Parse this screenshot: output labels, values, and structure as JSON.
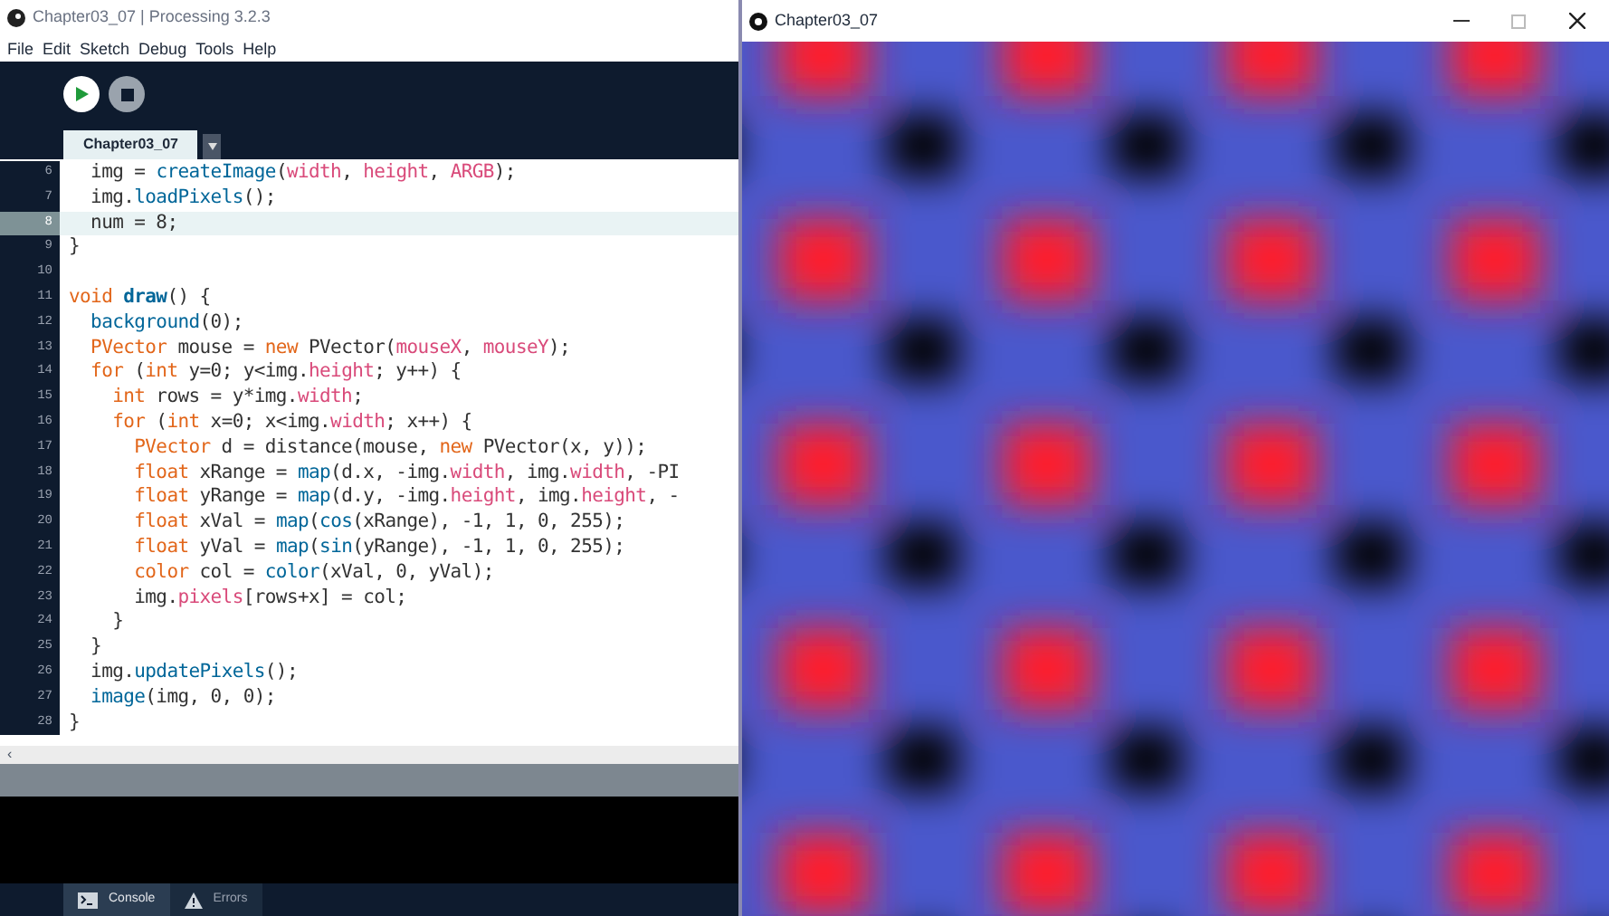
{
  "editor_window": {
    "title": "Chapter03_07 | Processing 3.2.3",
    "menu": [
      "File",
      "Edit",
      "Sketch",
      "Debug",
      "Tools",
      "Help"
    ],
    "tabs": [
      {
        "label": "Chapter03_07",
        "selected": true
      }
    ],
    "code_lines": [
      {
        "number": "6",
        "current": false,
        "tokens": [
          {
            "kind": "plain",
            "text": "  img = "
          },
          {
            "kind": "function",
            "text": "createImage"
          },
          {
            "kind": "plain",
            "text": "("
          },
          {
            "kind": "variable",
            "text": "width"
          },
          {
            "kind": "plain",
            "text": ", "
          },
          {
            "kind": "variable",
            "text": "height"
          },
          {
            "kind": "plain",
            "text": ", "
          },
          {
            "kind": "variable",
            "text": "ARGB"
          },
          {
            "kind": "plain",
            "text": ");"
          }
        ]
      },
      {
        "number": "7",
        "current": false,
        "tokens": [
          {
            "kind": "plain",
            "text": "  img."
          },
          {
            "kind": "function",
            "text": "loadPixels"
          },
          {
            "kind": "plain",
            "text": "();"
          }
        ]
      },
      {
        "number": "8",
        "current": true,
        "tokens": [
          {
            "kind": "plain",
            "text": "  num = 8;"
          }
        ]
      },
      {
        "number": "9",
        "current": false,
        "tokens": [
          {
            "kind": "plain",
            "text": "}"
          }
        ]
      },
      {
        "number": "10",
        "current": false
      },
      {
        "number": "11",
        "current": false,
        "tokens": [
          {
            "kind": "keyword",
            "text": "void "
          },
          {
            "kind": "definition",
            "text": "draw"
          },
          {
            "kind": "plain",
            "text": "() {"
          }
        ]
      },
      {
        "number": "12",
        "current": false,
        "tokens": [
          {
            "kind": "function",
            "text": "  background"
          },
          {
            "kind": "plain",
            "text": "(0);"
          }
        ]
      },
      {
        "number": "13",
        "current": false,
        "tokens": [
          {
            "kind": "keyword",
            "text": "  PVector"
          },
          {
            "kind": "plain",
            "text": " mouse = "
          },
          {
            "kind": "keyword",
            "text": "new"
          },
          {
            "kind": "plain",
            "text": " PVector("
          },
          {
            "kind": "variable",
            "text": "mouseX"
          },
          {
            "kind": "plain",
            "text": ", "
          },
          {
            "kind": "variable",
            "text": "mouseY"
          },
          {
            "kind": "plain",
            "text": ");"
          }
        ]
      },
      {
        "number": "14",
        "current": false,
        "tokens": [
          {
            "kind": "keyword",
            "text": "  for"
          },
          {
            "kind": "plain",
            "text": " ("
          },
          {
            "kind": "keyword",
            "text": "int"
          },
          {
            "kind": "plain",
            "text": " y=0; y<img."
          },
          {
            "kind": "variable",
            "text": "height"
          },
          {
            "kind": "plain",
            "text": "; y++) {"
          }
        ]
      },
      {
        "number": "15",
        "current": false,
        "tokens": [
          {
            "kind": "keyword",
            "text": "    int"
          },
          {
            "kind": "plain",
            "text": " rows = y*img."
          },
          {
            "kind": "variable",
            "text": "width"
          },
          {
            "kind": "plain",
            "text": ";"
          }
        ]
      },
      {
        "number": "16",
        "current": false,
        "tokens": [
          {
            "kind": "keyword",
            "text": "    for"
          },
          {
            "kind": "plain",
            "text": " ("
          },
          {
            "kind": "keyword",
            "text": "int"
          },
          {
            "kind": "plain",
            "text": " x=0; x<img."
          },
          {
            "kind": "variable",
            "text": "width"
          },
          {
            "kind": "plain",
            "text": "; x++) {"
          }
        ]
      },
      {
        "number": "17",
        "current": false,
        "tokens": [
          {
            "kind": "keyword",
            "text": "      PVector"
          },
          {
            "kind": "plain",
            "text": " d = distance(mouse, "
          },
          {
            "kind": "keyword",
            "text": "new"
          },
          {
            "kind": "plain",
            "text": " PVector(x, y));"
          }
        ]
      },
      {
        "number": "18",
        "current": false,
        "tokens": [
          {
            "kind": "keyword",
            "text": "      float"
          },
          {
            "kind": "plain",
            "text": " xRange = "
          },
          {
            "kind": "function",
            "text": "map"
          },
          {
            "kind": "plain",
            "text": "(d.x, -img."
          },
          {
            "kind": "variable",
            "text": "width"
          },
          {
            "kind": "plain",
            "text": ", img."
          },
          {
            "kind": "variable",
            "text": "width"
          },
          {
            "kind": "plain",
            "text": ", -PI"
          }
        ]
      },
      {
        "number": "19",
        "current": false,
        "tokens": [
          {
            "kind": "keyword",
            "text": "      float"
          },
          {
            "kind": "plain",
            "text": " yRange = "
          },
          {
            "kind": "function",
            "text": "map"
          },
          {
            "kind": "plain",
            "text": "(d.y, -img."
          },
          {
            "kind": "variable",
            "text": "height"
          },
          {
            "kind": "plain",
            "text": ", img."
          },
          {
            "kind": "variable",
            "text": "height"
          },
          {
            "kind": "plain",
            "text": ", -"
          }
        ]
      },
      {
        "number": "20",
        "current": false,
        "tokens": [
          {
            "kind": "keyword",
            "text": "      float"
          },
          {
            "kind": "plain",
            "text": " xVal = "
          },
          {
            "kind": "function",
            "text": "map"
          },
          {
            "kind": "plain",
            "text": "("
          },
          {
            "kind": "function",
            "text": "cos"
          },
          {
            "kind": "plain",
            "text": "(xRange), -1, 1, 0, 255);"
          }
        ]
      },
      {
        "number": "21",
        "current": false,
        "tokens": [
          {
            "kind": "keyword",
            "text": "      float"
          },
          {
            "kind": "plain",
            "text": " yVal = "
          },
          {
            "kind": "function",
            "text": "map"
          },
          {
            "kind": "plain",
            "text": "("
          },
          {
            "kind": "function",
            "text": "sin"
          },
          {
            "kind": "plain",
            "text": "(yRange), -1, 1, 0, 255);"
          }
        ]
      },
      {
        "number": "22",
        "current": false,
        "tokens": [
          {
            "kind": "keyword",
            "text": "      color"
          },
          {
            "kind": "plain",
            "text": " col = "
          },
          {
            "kind": "function",
            "text": "color"
          },
          {
            "kind": "plain",
            "text": "(xVal, 0, yVal);"
          }
        ]
      },
      {
        "number": "23",
        "current": false,
        "tokens": [
          {
            "kind": "plain",
            "text": "      img."
          },
          {
            "kind": "variable",
            "text": "pixels"
          },
          {
            "kind": "plain",
            "text": "[rows+x] = col;"
          }
        ]
      },
      {
        "number": "24",
        "current": false,
        "tokens": [
          {
            "kind": "plain",
            "text": "    }"
          }
        ]
      },
      {
        "number": "25",
        "current": false,
        "tokens": [
          {
            "kind": "plain",
            "text": "  }"
          }
        ]
      },
      {
        "number": "26",
        "current": false,
        "tokens": [
          {
            "kind": "plain",
            "text": "  img."
          },
          {
            "kind": "function",
            "text": "updatePixels"
          },
          {
            "kind": "plain",
            "text": "();"
          }
        ]
      },
      {
        "number": "27",
        "current": false,
        "tokens": [
          {
            "kind": "function",
            "text": "  image"
          },
          {
            "kind": "plain",
            "text": "(img, 0, 0);"
          }
        ]
      },
      {
        "number": "28",
        "current": false,
        "tokens": [
          {
            "kind": "plain",
            "text": "}"
          }
        ]
      }
    ],
    "scroll_left": "‹",
    "bottom_tabs": [
      {
        "label": "Console",
        "kind": "console",
        "selected": true
      },
      {
        "label": "Errors",
        "kind": "errors",
        "selected": false
      }
    ]
  },
  "sketch_window": {
    "title": "Chapter03_07"
  }
}
